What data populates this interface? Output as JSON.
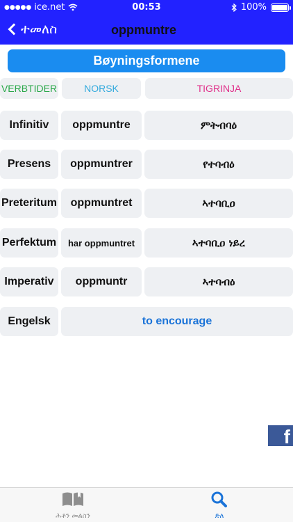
{
  "status": {
    "carrier": "ice.net",
    "time": "00:53",
    "battery": "100%"
  },
  "nav": {
    "back_label": "ተመለስ",
    "title": "oppmuntre"
  },
  "header_button": "Bøyningsformene",
  "columns": {
    "verbtider": "VERBTIDER",
    "norsk": "NORSK",
    "tigrinja": "TIGRINJA"
  },
  "rows": [
    {
      "tense": "Infinitiv",
      "norsk": "oppmuntre",
      "tigrinja": "ምትብባዕ"
    },
    {
      "tense": "Presens",
      "norsk": "oppmuntrer",
      "tigrinja": "የተባብዕ"
    },
    {
      "tense": "Preteritum",
      "norsk": "oppmuntret",
      "tigrinja": "ኣተባቢዐ"
    },
    {
      "tense": "Perfektum",
      "norsk": "har oppmuntret",
      "tigrinja": "ኣተባቢዐ ነይረ"
    },
    {
      "tense": "Imperativ",
      "norsk": "oppmuntr",
      "tigrinja": "ኣተባብዕ"
    }
  ],
  "engelsk": {
    "label": "Engelsk",
    "value": "to encourage"
  },
  "facebook": {
    "glyph": "f"
  },
  "tabs": [
    {
      "label": "ሕቶን መልስን",
      "icon": "book-icon"
    },
    {
      "label": "ድለ",
      "icon": "search-icon"
    }
  ],
  "colors": {
    "nav_bg": "#2222ff",
    "accent": "#1a8cf0",
    "green": "#2aa84a",
    "teal": "#33aadd",
    "pink": "#e0308a",
    "facebook": "#3b5998"
  }
}
